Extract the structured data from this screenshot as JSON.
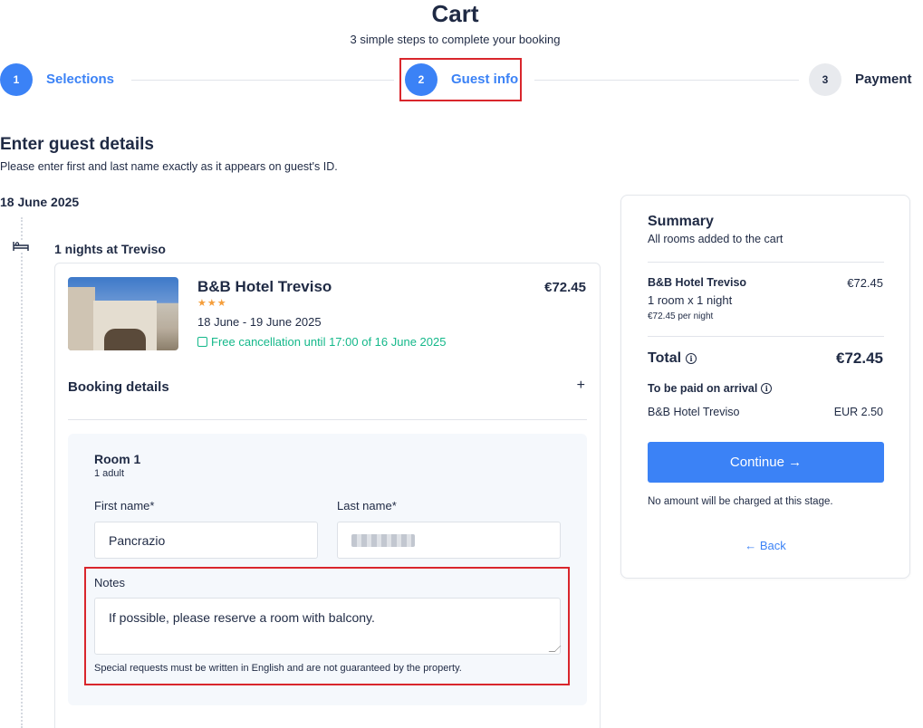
{
  "header": {
    "title": "Cart",
    "subtitle": "3 simple steps to complete your booking"
  },
  "steps": [
    {
      "number": "1",
      "label": "Selections"
    },
    {
      "number": "2",
      "label": "Guest info"
    },
    {
      "number": "3",
      "label": "Payment"
    }
  ],
  "guest": {
    "title": "Enter guest details",
    "subtitle": "Please enter first and last name exactly as it appears on guest's ID.",
    "date": "18 June 2025",
    "nights": "1 nights at Treviso"
  },
  "hotel": {
    "name": "B&B Hotel Treviso",
    "stars": "★★★",
    "dates": "18 June - 19 June 2025",
    "cancellation": "Free cancellation until 17:00 of 16 June 2025",
    "price": "€72.45",
    "booking_details_label": "Booking details",
    "expand_symbol": "+"
  },
  "room": {
    "title": "Room 1",
    "adults": "1 adult",
    "first_name_label": "First name*",
    "first_name_value": "Pancrazio",
    "last_name_label": "Last name*",
    "notes_label": "Notes",
    "notes_value": "If possible, please reserve a room with balcony.",
    "notes_help": "Special requests must be written in English and are not guaranteed by the property."
  },
  "summary": {
    "title": "Summary",
    "subtitle": "All rooms added to the cart",
    "hotel": "B&B Hotel Treviso",
    "hotel_price": "€72.45",
    "rooms": "1 room x 1 night",
    "per_night": "€72.45 per night",
    "total_label": "Total",
    "total_value": "€72.45",
    "arrival_label": "To be paid on arrival",
    "arrival_hotel": "B&B Hotel Treviso",
    "arrival_amount": "EUR 2.50",
    "continue_label": "Continue →",
    "no_charge": "No amount will be charged at this stage.",
    "back_label": "← Back"
  },
  "colors": {
    "accent": "#3b82f6",
    "text": "#1f2a44",
    "success": "#14b88a",
    "highlight": "#d9262c",
    "star": "#f59e3b"
  }
}
